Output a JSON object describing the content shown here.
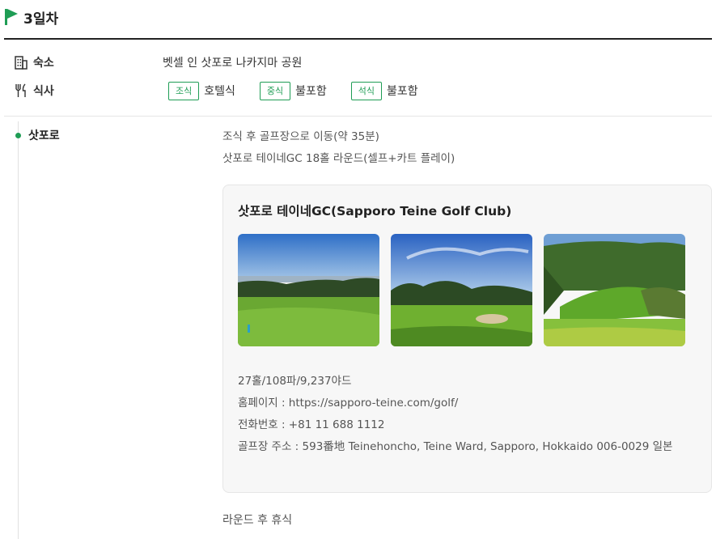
{
  "day": {
    "title": "3일차",
    "accent_color": "#1f9d55"
  },
  "accommodation": {
    "icon": "building-icon",
    "label": "숙소",
    "value": "벳셀 인 삿포로 나카지마 공원"
  },
  "meals": {
    "icon": "utensils-icon",
    "label": "식사",
    "items": [
      {
        "tag": "조식",
        "value": "호텔식"
      },
      {
        "tag": "중식",
        "value": "불포함"
      },
      {
        "tag": "석식",
        "value": "불포함"
      }
    ]
  },
  "timeline": {
    "place": "삿포로",
    "descriptions": [
      "조식 후 골프장으로 이동(약 35분)",
      "삿포로 테이네GC 18홀 라운드(셀프+카트 플레이)"
    ],
    "golf_card": {
      "title": "삿포로 테이네GC(Sapporo Teine Golf Club)",
      "photos": [
        "golf-course-photo-1",
        "golf-course-photo-2",
        "golf-course-photo-3"
      ],
      "details": [
        "27홀/108파/9,237야드",
        "홈페이지 : https://sapporo-teine.com/golf/",
        "전화번호 : +81 11 688 1112",
        "골프장 주소 : 593番地 Teinehoncho, Teine Ward, Sapporo, Hokkaido 006-0029 일본"
      ]
    },
    "after": "라운드 후 휴식"
  }
}
